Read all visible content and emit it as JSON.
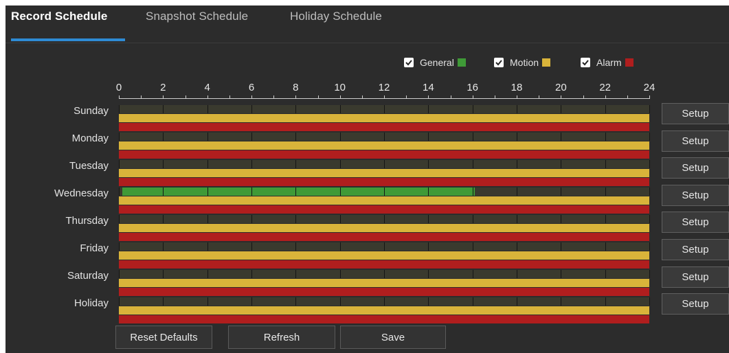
{
  "tabs": [
    {
      "label": "Record Schedule",
      "active": true
    },
    {
      "label": "Snapshot Schedule",
      "active": false
    },
    {
      "label": "Holiday Schedule",
      "active": false
    }
  ],
  "legend": [
    {
      "label": "General",
      "checked": true,
      "color": "#3f9a37"
    },
    {
      "label": "Motion",
      "checked": true,
      "color": "#d9b43a"
    },
    {
      "label": "Alarm",
      "checked": true,
      "color": "#b01e1e"
    }
  ],
  "axis": {
    "ticks": [
      "0",
      "2",
      "4",
      "6",
      "8",
      "10",
      "12",
      "14",
      "16",
      "18",
      "20",
      "22",
      "24"
    ],
    "min": 0,
    "max": 24
  },
  "days": [
    {
      "label": "Sunday",
      "general": [],
      "motion": [
        [
          0,
          24
        ]
      ],
      "alarm": [
        [
          0,
          24
        ]
      ]
    },
    {
      "label": "Monday",
      "general": [],
      "motion": [
        [
          0,
          24
        ]
      ],
      "alarm": [
        [
          0,
          24
        ]
      ]
    },
    {
      "label": "Tuesday",
      "general": [],
      "motion": [
        [
          0,
          24
        ]
      ],
      "alarm": [
        [
          0,
          24
        ]
      ]
    },
    {
      "label": "Wednesday",
      "general": [
        [
          0.15,
          16.1
        ]
      ],
      "motion": [
        [
          0,
          24
        ]
      ],
      "alarm": [
        [
          0,
          24
        ]
      ]
    },
    {
      "label": "Thursday",
      "general": [],
      "motion": [
        [
          0,
          24
        ]
      ],
      "alarm": [
        [
          0,
          24
        ]
      ]
    },
    {
      "label": "Friday",
      "general": [],
      "motion": [
        [
          0,
          24
        ]
      ],
      "alarm": [
        [
          0,
          24
        ]
      ]
    },
    {
      "label": "Saturday",
      "general": [],
      "motion": [
        [
          0,
          24
        ]
      ],
      "alarm": [
        [
          0,
          24
        ]
      ]
    },
    {
      "label": "Holiday",
      "general": [],
      "motion": [
        [
          0,
          24
        ]
      ],
      "alarm": [
        [
          0,
          24
        ]
      ]
    }
  ],
  "setup_label": "Setup",
  "buttons": {
    "reset": "Reset Defaults",
    "refresh": "Refresh",
    "save": "Save"
  }
}
